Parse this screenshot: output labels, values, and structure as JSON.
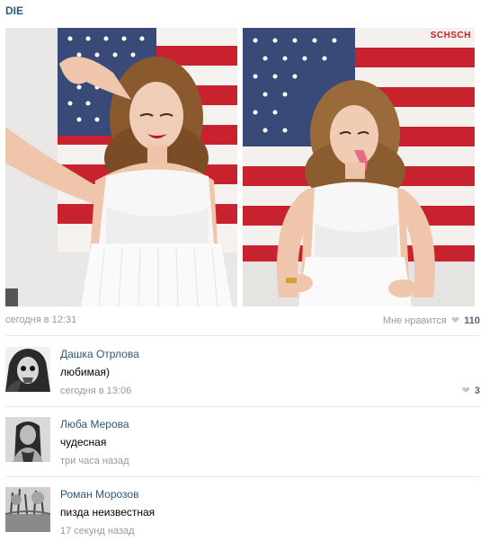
{
  "post": {
    "title": "DIE",
    "watermark": "SCHSCH",
    "time": "сегодня в 12:31",
    "like_label": "Мне нравится",
    "like_count": "110"
  },
  "comments": [
    {
      "author": "Дашка Отрлова",
      "text": "любимая)",
      "time": "сегодня в 13:06",
      "likes": "3"
    },
    {
      "author": "Люба Мерова",
      "text": "чудесная",
      "time": "три часа назад"
    },
    {
      "author": "Роман Морозов",
      "text": "пизда неизвестная",
      "time": "17 секунд назад"
    }
  ],
  "colors": {
    "link": "#2b587a",
    "muted": "#999999",
    "flag_red": "#c8222e",
    "flag_blue": "#3a4a78"
  }
}
